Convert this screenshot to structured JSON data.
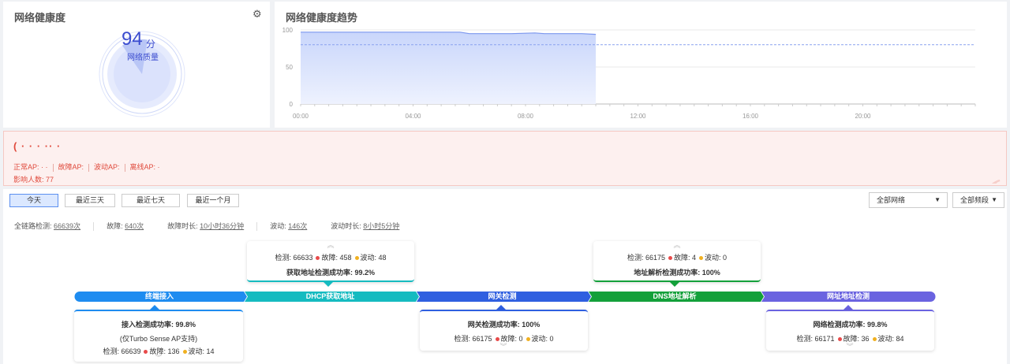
{
  "health": {
    "title": "网络健康度",
    "score": 94,
    "unit": "分",
    "label": "网络质量",
    "score_fraction": 0.94
  },
  "trend": {
    "title": "网络健康度趋势",
    "chart_data": {
      "type": "area",
      "x_ticks": [
        "00:00",
        "04:00",
        "08:00",
        "12:00",
        "16:00",
        "20:00"
      ],
      "y_ticks": [
        0,
        50,
        100
      ],
      "ylim": [
        0,
        100
      ],
      "xlim": [
        "00:00",
        "24:00"
      ],
      "series_points": [
        {
          "x": "00:00",
          "y": 97
        },
        {
          "x": "02:00",
          "y": 97
        },
        {
          "x": "05:40",
          "y": 97
        },
        {
          "x": "06:00",
          "y": 95
        },
        {
          "x": "07:30",
          "y": 95
        },
        {
          "x": "08:20",
          "y": 96
        },
        {
          "x": "08:40",
          "y": 95
        },
        {
          "x": "10:00",
          "y": 95
        },
        {
          "x": "10:30",
          "y": 94
        }
      ],
      "reference_line": 80,
      "grid": true
    }
  },
  "alert": {
    "title": "( · · ·  ·· ·",
    "normal_ap": "正常AP: · ·",
    "fault_ap": "故障AP:",
    "flap_ap": "波动AP:",
    "offline_ap": "离线AP:  ·",
    "affected": "影响人数: 77"
  },
  "tabs": [
    "今天",
    "最近三天",
    "最近七天",
    "最近一个月"
  ],
  "filters": {
    "network": "全部网络",
    "band": "全部频段"
  },
  "stats": {
    "total_label": "全链路检测:",
    "total_value": "66639次",
    "fault_label": "故障:",
    "fault_value": "640次",
    "fault_dur_label": "故障时长:",
    "fault_dur_value": "10小时36分钟",
    "flap_label": "波动:",
    "flap_value": "146次",
    "flap_dur_label": "波动时长:",
    "flap_dur_value": "8小时5分钟"
  },
  "stages": [
    {
      "name": "终端接入",
      "color": "#1e8cf0"
    },
    {
      "name": "DHCP获取地址",
      "color": "#15bbc0"
    },
    {
      "name": "网关检测",
      "color": "#2f5fe0"
    },
    {
      "name": "DNS地址解析",
      "color": "#13a03a"
    },
    {
      "name": "网址地址检测",
      "color": "#6a63e0"
    }
  ],
  "cards": {
    "terminal": {
      "rate": "接入检测成功率: 99.8%",
      "note": "(仅Turbo Sense AP支持)",
      "detect": "检测: 66639",
      "fault": "故障: 136",
      "flap": "波动: 14"
    },
    "dhcp": {
      "detect": "检测: 66633",
      "fault": "故障: 458",
      "flap": "波动: 48",
      "rate": "获取地址检测成功率: 99.2%"
    },
    "gateway": {
      "rate": "网关检测成功率: 100%",
      "detect": "检测: 66175",
      "fault": "故障: 0",
      "flap": "波动: 0"
    },
    "dns": {
      "detect": "检测: 66175",
      "fault": "故障: 4",
      "flap": "波动: 0",
      "rate": "地址解析检测成功率: 100%"
    },
    "web": {
      "rate": "网络检测成功率: 99.8%",
      "detect": "检测: 66171",
      "fault": "故障: 36",
      "flap": "波动: 84"
    }
  },
  "colors": {
    "fault_dot": "#e84a4a",
    "flap_dot": "#f0b020",
    "accent": "#3b4ccf"
  }
}
